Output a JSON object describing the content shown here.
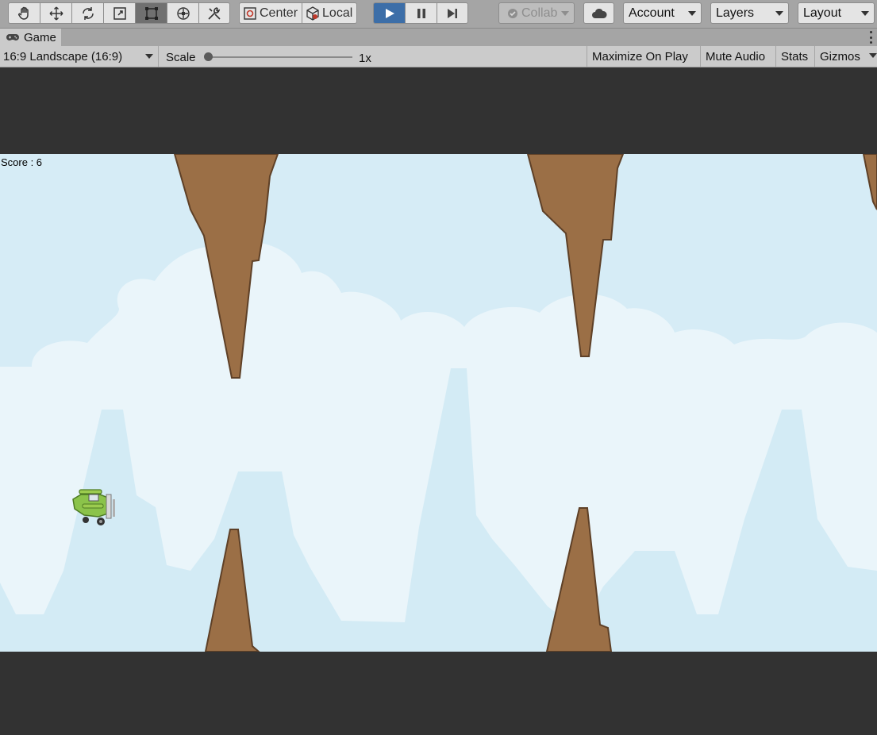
{
  "toolbar": {
    "tools": [
      {
        "name": "hand-tool",
        "icon": "hand-icon"
      },
      {
        "name": "move-tool",
        "icon": "move-icon"
      },
      {
        "name": "rotate-tool",
        "icon": "rotate-icon"
      },
      {
        "name": "scale-tool",
        "icon": "scale-icon"
      },
      {
        "name": "rect-tool",
        "icon": "rect-transform-icon",
        "selected": true
      },
      {
        "name": "transform-tool",
        "icon": "transform-icon"
      },
      {
        "name": "custom-tool",
        "icon": "custom-tools-icon"
      }
    ],
    "pivot_mode": "Center",
    "pivot_rotation": "Local",
    "playing": true,
    "collab": "Collab",
    "account": "Account",
    "layers": "Layers",
    "layout": "Layout"
  },
  "game_tab": {
    "title": "Game",
    "icon": "gamepad-icon"
  },
  "game_toolbar": {
    "aspect": "16:9 Landscape (16:9)",
    "scale_label": "Scale",
    "scale_value": "1x",
    "scale_fraction": 0.0,
    "maximize_on_play": "Maximize On Play",
    "mute_audio": "Mute Audio",
    "stats": "Stats",
    "gizmos": "Gizmos"
  },
  "game": {
    "score_text": "Score : 6",
    "sky_color": "#d6ecf6",
    "cloud_color": "#eaf5fa",
    "rock_color": "#9b6f46"
  }
}
